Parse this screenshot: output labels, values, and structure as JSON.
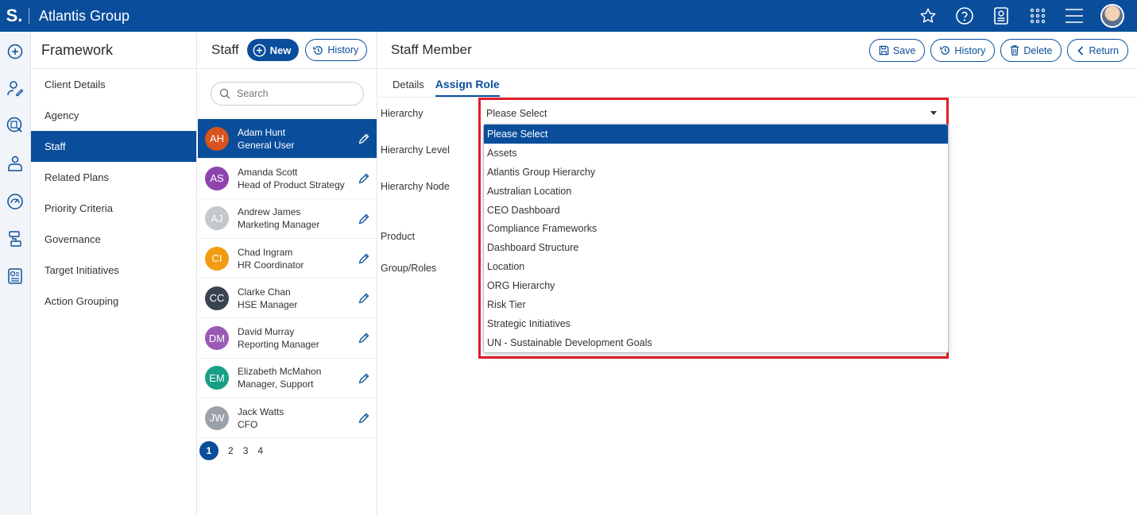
{
  "app": {
    "logo": "S.",
    "title": "Atlantis Group"
  },
  "topbar_icons": [
    "star-icon",
    "help-icon",
    "report-icon",
    "apps-grid-icon",
    "menu-icon",
    "user-avatar"
  ],
  "rail_icons": [
    "add-circle-icon",
    "user-edit-icon",
    "search-doc-icon",
    "person-icon",
    "speedometer-icon",
    "hierarchy-icon",
    "chart-doc-icon"
  ],
  "framework": {
    "title": "Framework",
    "items": [
      {
        "label": "Client Details"
      },
      {
        "label": "Agency"
      },
      {
        "label": "Staff",
        "active": true
      },
      {
        "label": "Related Plans"
      },
      {
        "label": "Priority Criteria"
      },
      {
        "label": "Governance"
      },
      {
        "label": "Target Initiatives"
      },
      {
        "label": "Action Grouping"
      }
    ]
  },
  "staff": {
    "title": "Staff",
    "new_label": "New",
    "history_label": "History",
    "search_placeholder": "Search",
    "members": [
      {
        "initials": "AH",
        "name": "Adam Hunt",
        "role": "General User",
        "color": "#d9531e",
        "active": true
      },
      {
        "initials": "AS",
        "name": "Amanda Scott",
        "role": "Head of Product Strategy",
        "color": "#8e44ad"
      },
      {
        "initials": "AJ",
        "name": "Andrew James",
        "role": "Marketing Manager",
        "color": "#c4c7cc"
      },
      {
        "initials": "CI",
        "name": "Chad Ingram",
        "role": "HR Coordinator",
        "color": "#f39c12"
      },
      {
        "initials": "CC",
        "name": "Clarke Chan",
        "role": "HSE Manager",
        "color": "#3a4450"
      },
      {
        "initials": "DM",
        "name": "David Murray",
        "role": "Reporting Manager",
        "color": "#9b59b6"
      },
      {
        "initials": "EM",
        "name": "Elizabeth McMahon",
        "role": "Manager, Support",
        "color": "#16a085"
      },
      {
        "initials": "JW",
        "name": "Jack Watts",
        "role": "CFO",
        "color": "#9aa1a8"
      }
    ],
    "pages": [
      "1",
      "2",
      "3",
      "4"
    ],
    "current_page": "1"
  },
  "main": {
    "title": "Staff Member",
    "actions": {
      "save": "Save",
      "history": "History",
      "delete": "Delete",
      "return": "Return"
    },
    "tabs": [
      {
        "label": "Details"
      },
      {
        "label": "Assign Role",
        "active": true
      }
    ],
    "fields": {
      "hierarchy": "Hierarchy",
      "hierarchy_level": "Hierarchy Level",
      "hierarchy_node": "Hierarchy Node",
      "product": "Product",
      "group_roles": "Group/Roles"
    },
    "hierarchy_select": {
      "value": "Please Select",
      "options": [
        "Please Select",
        "Assets",
        "Atlantis Group Hierarchy",
        "Australian Location",
        "CEO Dashboard",
        "Compliance Frameworks",
        "Dashboard Structure",
        "Location",
        "ORG Hierarchy",
        "Risk Tier",
        "Strategic Initiatives",
        "UN - Sustainable Development Goals"
      ],
      "highlighted": "Please Select"
    }
  },
  "colors": {
    "brand": "#0a4e9b",
    "highlight_box": "#e21d2b"
  }
}
